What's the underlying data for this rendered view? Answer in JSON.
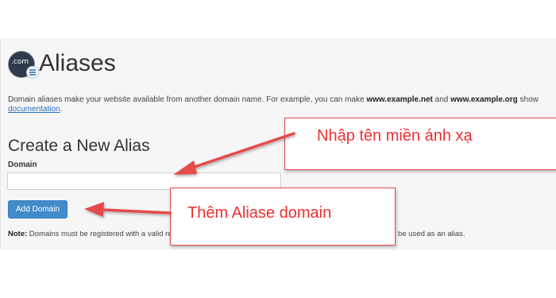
{
  "header": {
    "icon_text": ".com",
    "title": "Aliases"
  },
  "description": {
    "text_before": "Domain aliases make your website available from another domain name. For example, you can make ",
    "example_net": "www.example.net",
    "text_and": " and ",
    "example_org": "www.example.org",
    "text_after": " show",
    "doc_link": "documentation",
    "doc_period": "."
  },
  "create_section": {
    "title": "Create a New Alias",
    "domain_label": "Domain",
    "domain_value": "",
    "add_button_label": "Add Domain"
  },
  "note": {
    "label": "Note:",
    "text": " Domains must be registered with a valid registrar and configured to point to your DNS servers before they can be used as an alias."
  },
  "annotations": {
    "callout_1": "Nhập tên miền ánh xạ",
    "callout_2": "Thêm Aliase domain",
    "color": "#ee3030"
  },
  "colors": {
    "button": "#428bca",
    "link": "#2a6ebb",
    "annotation_red": "#ee3030"
  }
}
